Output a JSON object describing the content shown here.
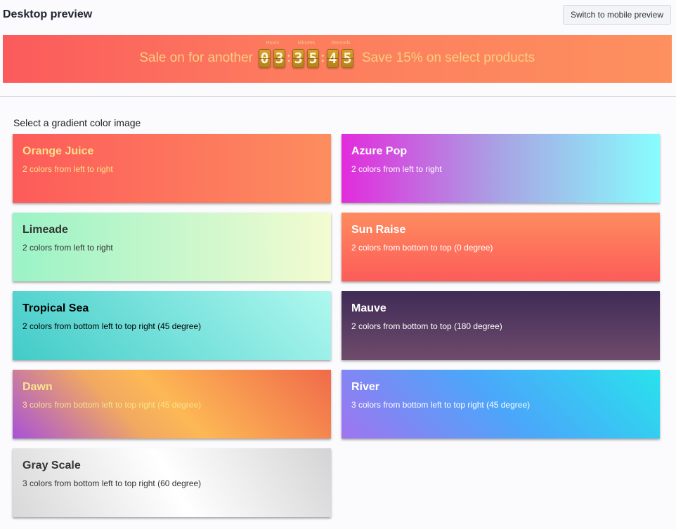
{
  "header": {
    "title": "Desktop preview",
    "switch_label": "Switch to mobile preview"
  },
  "banner": {
    "lead_text": "Sale on for another",
    "tail_text": "Save 15% on select products",
    "countdown": {
      "hours_label": "Hours",
      "minutes_label": "Minutes",
      "seconds_label": "Seconds",
      "hours": [
        "0",
        "3"
      ],
      "minutes": [
        "3",
        "5"
      ],
      "seconds": [
        "4",
        "5"
      ]
    }
  },
  "gradients": {
    "prompt": "Select a gradient color image",
    "items": [
      {
        "name": "Orange Juice",
        "description": "2 colors from left to right",
        "colors": [
          "#fd5b5a",
          "#fd8d5f"
        ]
      },
      {
        "name": "Azure Pop",
        "description": "2 colors from left to right",
        "colors": [
          "#e22bdc",
          "#87fdfd"
        ]
      },
      {
        "name": "Limeade",
        "description": "2 colors from left to right",
        "colors": [
          "#9af3c6",
          "#f4fbd1"
        ]
      },
      {
        "name": "Sun Raise",
        "description": "2 colors from bottom to top (0 degree)",
        "colors": [
          "#fd5c59",
          "#fd8c5e"
        ]
      },
      {
        "name": "Tropical Sea",
        "description": "2 colors from bottom left to top right (45 degree)",
        "colors": [
          "#42cbc8",
          "#aff8ef"
        ]
      },
      {
        "name": "Mauve",
        "description": "2 colors from bottom to top (180 degree)",
        "colors": [
          "#3f2b57",
          "#6f4b6b"
        ]
      },
      {
        "name": "Dawn",
        "description": "3 colors from bottom left to top right (45 degree)",
        "colors": [
          "#a752d8",
          "#fdb855",
          "#f06a4a"
        ]
      },
      {
        "name": "River",
        "description": "3 colors from bottom left to top right (45 degree)",
        "colors": [
          "#a074f0",
          "#4aa7fa",
          "#28e3ec"
        ]
      },
      {
        "name": "Gray Scale",
        "description": "3 colors from bottom left to top right (60 degree)",
        "colors": [
          "#d8d8d8",
          "#ffffff",
          "#d4d4d4"
        ]
      }
    ]
  }
}
